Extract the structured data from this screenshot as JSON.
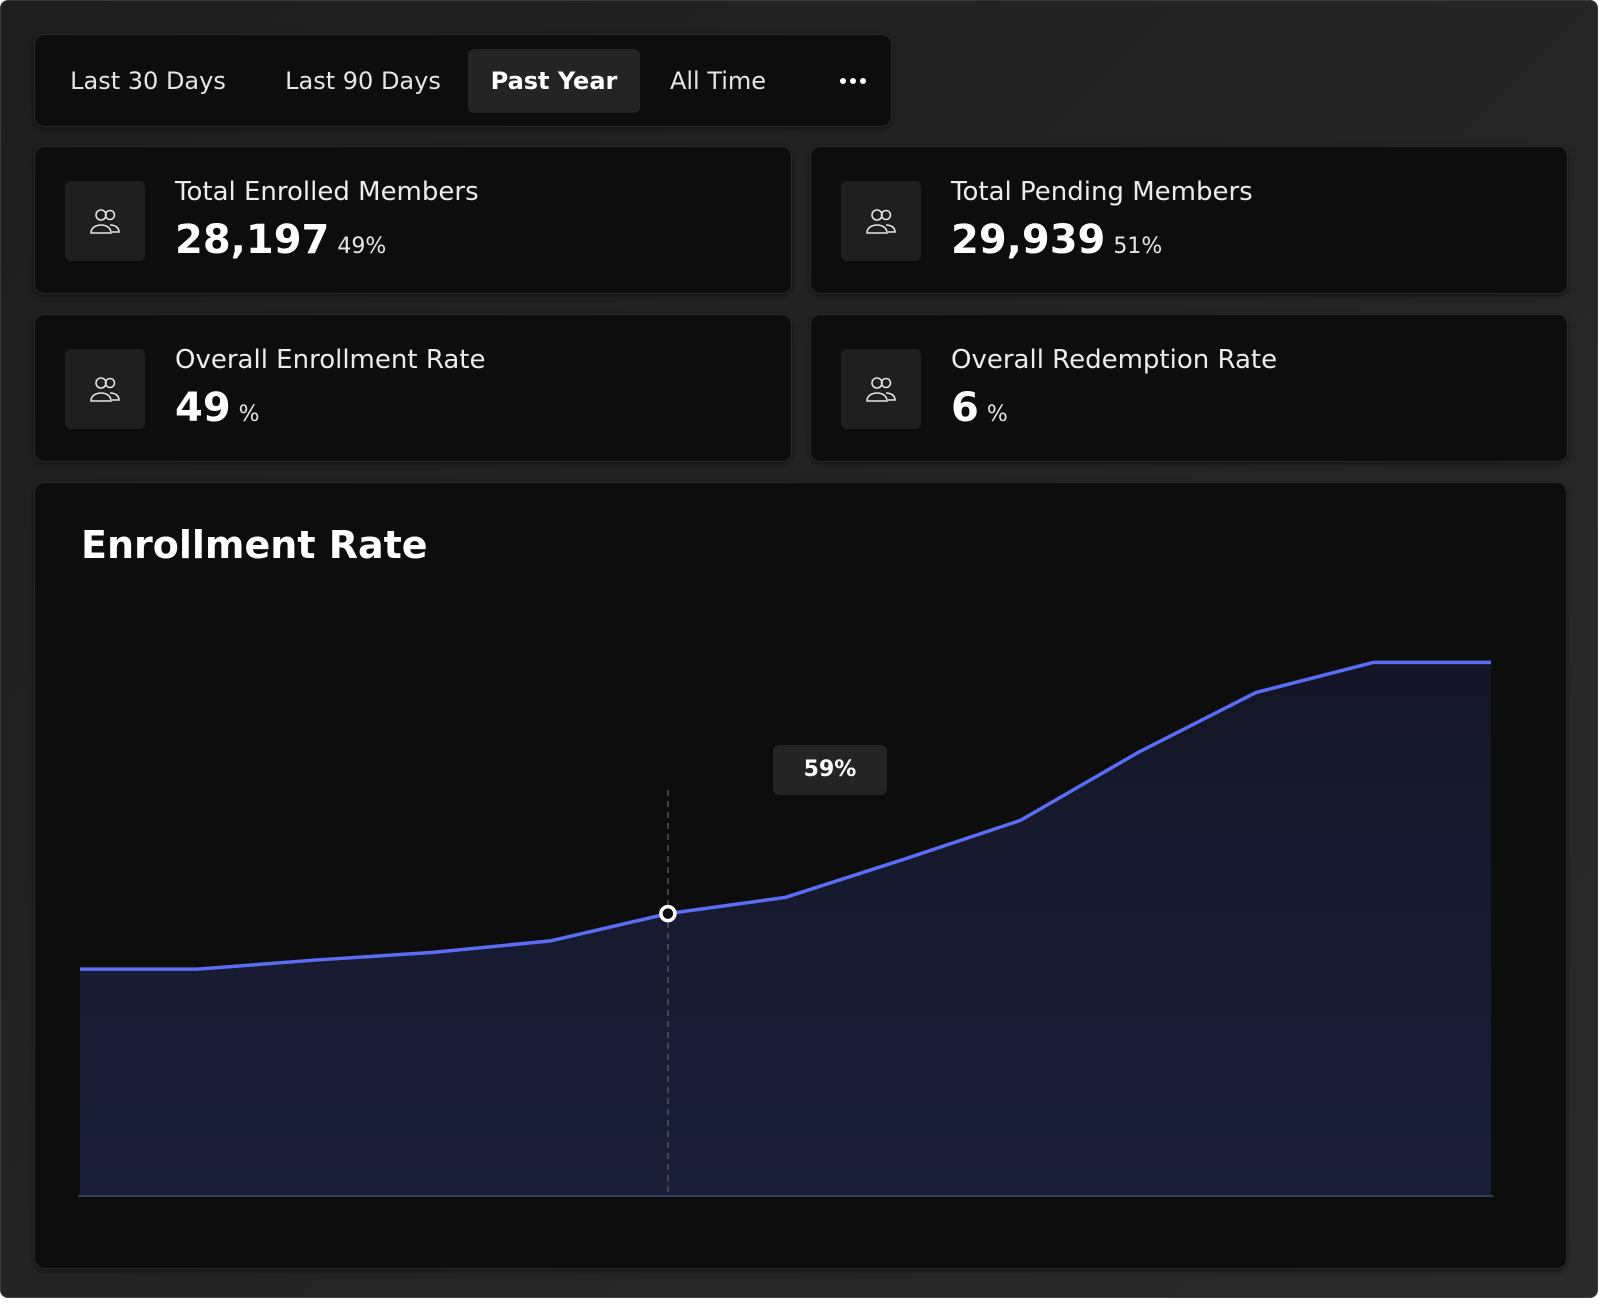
{
  "tabs": {
    "items": [
      {
        "label": "Last 30 Days"
      },
      {
        "label": "Last 90 Days"
      },
      {
        "label": "Past Year"
      },
      {
        "label": "All Time"
      }
    ],
    "active": "Past Year",
    "more_icon": "more-horizontal-icon"
  },
  "stats": {
    "enrolled": {
      "label": "Total Enrolled Members",
      "value": "28,197",
      "sub": "49%",
      "icon": "users-icon"
    },
    "pending": {
      "label": "Total Pending Members",
      "value": "29,939",
      "sub": "51%",
      "icon": "users-icon"
    },
    "enrollment_rate": {
      "label": "Overall Enrollment Rate",
      "value": "49",
      "sub": "%",
      "icon": "users-icon"
    },
    "redemption_rate": {
      "label": "Overall Redemption Rate",
      "value": "6",
      "sub": "%",
      "icon": "users-icon"
    }
  },
  "chart": {
    "title": "Enrollment Rate",
    "tooltip": "59%"
  },
  "chart_data": {
    "type": "area",
    "title": "Enrollment Rate",
    "xlabel": "",
    "ylabel": "",
    "x": [
      0,
      1,
      2,
      3,
      4,
      5,
      6,
      7,
      8,
      9,
      10,
      11,
      12
    ],
    "values": [
      47.4,
      47.4,
      49.3,
      50.9,
      53.3,
      59,
      62.4,
      70.3,
      78.5,
      92.7,
      105.2,
      111.5,
      111.5
    ],
    "ylim": [
      0,
      140
    ],
    "highlight": {
      "index": 5,
      "label": "59%"
    },
    "grid": false,
    "line_color": "#5b6cf5",
    "fill_color": "#1a1f3a"
  },
  "colors": {
    "background": "#232323",
    "card": "#0d0d0d",
    "icon_bg": "#1f1f1f",
    "accent": "#5b6cf5"
  }
}
